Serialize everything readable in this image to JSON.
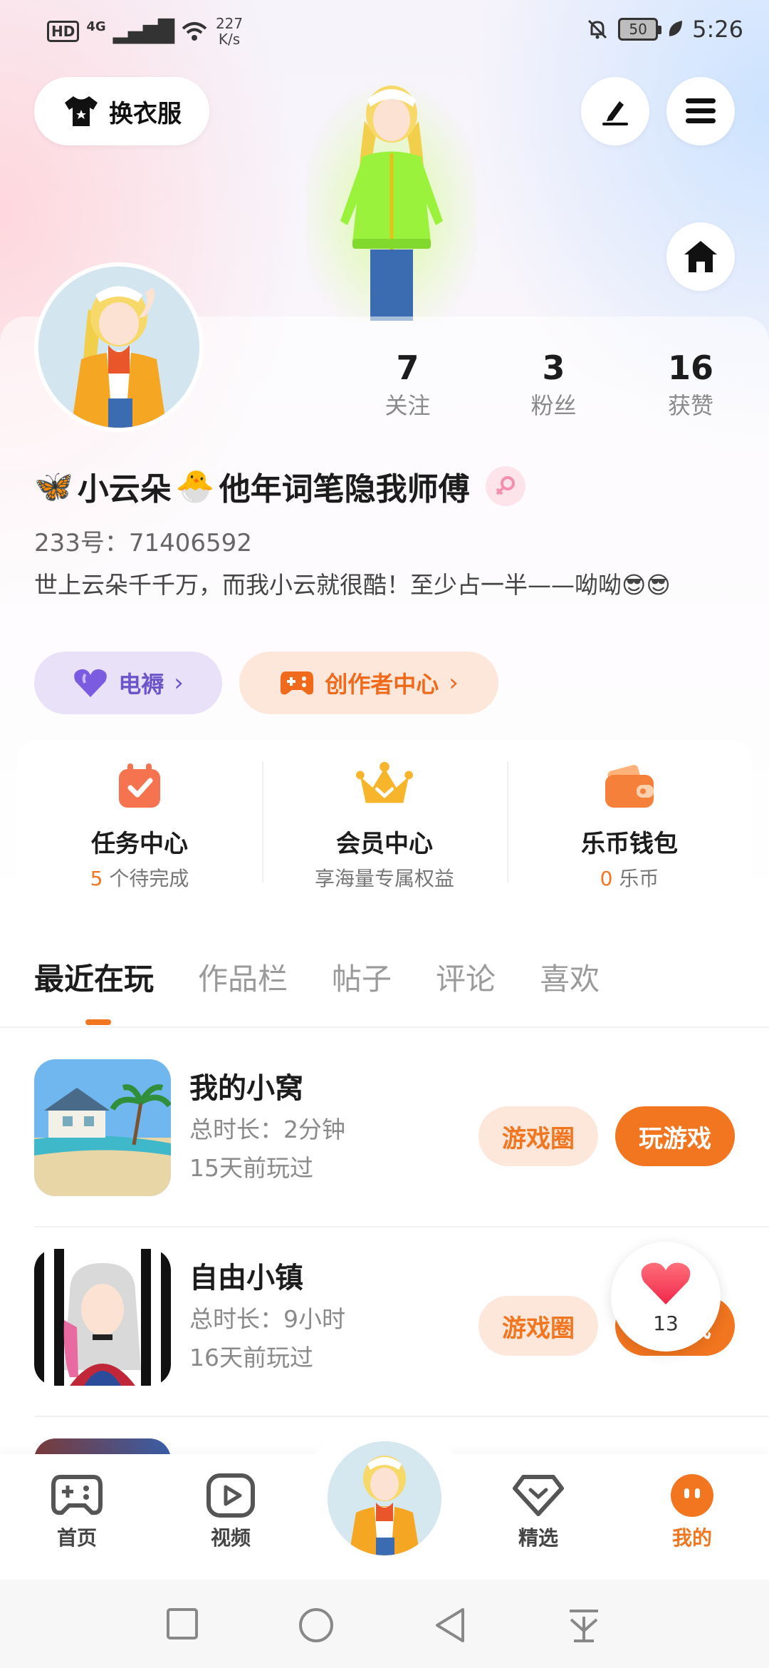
{
  "status_bar": {
    "hd": "HD",
    "network": "4G",
    "speed_value": "227",
    "speed_unit": "K/s",
    "battery": "50",
    "time": "5:26"
  },
  "top_bar": {
    "dress_label": "换衣服"
  },
  "profile": {
    "stats": [
      {
        "value": "7",
        "label": "关注"
      },
      {
        "value": "3",
        "label": "粉丝"
      },
      {
        "value": "16",
        "label": "获赞"
      }
    ],
    "name_prefix_emoji": "🦋",
    "name_part1": "小云朵",
    "name_mid_emoji": "🐣",
    "name_part2": "他年词笔隐我师傅",
    "uid": "233号：71406592",
    "bio": "世上云朵千千万，而我小云就很酷！至少占一半——呦呦😎😎"
  },
  "pills": {
    "dianhu": "电褥",
    "creator": "创作者中心"
  },
  "services": [
    {
      "title": "任务中心",
      "sub_value": "5",
      "sub_text": " 个待完成"
    },
    {
      "title": "会员中心",
      "sub_value": "",
      "sub_text": "享海量专属权益"
    },
    {
      "title": "乐币钱包",
      "sub_value": "0",
      "sub_text": " 乐币"
    }
  ],
  "tabs": [
    "最近在玩",
    "作品栏",
    "帖子",
    "评论",
    "喜欢"
  ],
  "games": [
    {
      "title": "我的小窝",
      "duration": "总时长：2分钟",
      "last_played": "15天前玩过",
      "circle_label": "游戏圈",
      "play_label": "玩游戏"
    },
    {
      "title": "自由小镇",
      "duration": "总时长：9小时",
      "last_played": "16天前玩过",
      "circle_label": "游戏圈",
      "play_label": "玩游戏"
    }
  ],
  "like_float": {
    "count": "13"
  },
  "bottom_nav": [
    {
      "label": "首页"
    },
    {
      "label": "视频"
    },
    {
      "label": "精选"
    },
    {
      "label": "我的"
    }
  ],
  "colors": {
    "accent": "#f2751f",
    "purple": "#6b55c9"
  }
}
